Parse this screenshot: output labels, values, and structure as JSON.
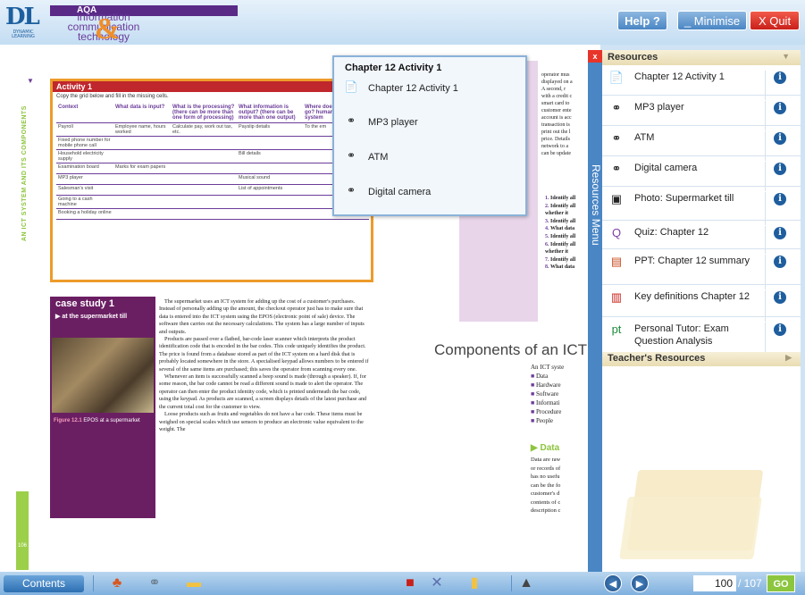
{
  "header": {
    "logo_big": "DL",
    "logo_small": "DYNAMIC LEARNING",
    "badge": "AQA",
    "title_lines": [
      "information",
      "communication",
      "technology"
    ],
    "amp": "&",
    "help": "Help ?",
    "minimise": "_ Minimise",
    "quit": "X Quit"
  },
  "book": {
    "side_label": "AN ICT SYSTEM AND ITS COMPONENTS",
    "page_number": "106",
    "activity": {
      "title": "Activity 1",
      "intro": "Copy the grid below and fill in the missing cells.",
      "columns": [
        "Context",
        "What data is input?",
        "What is the processing? (there can be more than one form of processing)",
        "What information is output? (there can be more than one output)",
        "Where does the output go? human or ICT system"
      ],
      "rows": [
        [
          "Payroll",
          "Employee name, hours worked",
          "Calculate pay, work out tax, etc.",
          "Payslip details",
          "To the em"
        ],
        [
          "Fixed phone number for mobile phone call",
          "",
          "",
          "",
          ""
        ],
        [
          "Household electricity supply",
          "",
          "",
          "Bill details",
          ""
        ],
        [
          "Examination board",
          "Marks for exam papers",
          "",
          "",
          ""
        ],
        [
          "MP3 player",
          "",
          "",
          "Musical sound",
          ""
        ],
        [
          "Salesman's visit",
          "",
          "",
          "List of appointments",
          ""
        ],
        [
          "Going to a cash machine",
          "",
          "",
          "",
          ""
        ],
        [
          "Booking a holiday online",
          "",
          "",
          "",
          ""
        ]
      ]
    },
    "case_study": {
      "title": "case study 1",
      "subtitle": "▶ at the supermarket till",
      "caption_label": "Figure 12.1",
      "caption": "EPOS at a supermarket",
      "paragraphs": [
        "The supermarket uses an ICT system for adding up the cost of a customer's purchases. Instead of personally adding up the amount, the checkout operator just has to make sure that data is entered into the ICT system using the EPOS (electronic point of sale) device. The software then carries out the necessary calculations. The system has a large number of inputs and outputs.",
        "Products are passed over a flatbed, bar-code laser scanner which interprets the product identification code that is encoded in the bar codes. This code uniquely identifies the product. The price is found from a database stored as part of the ICT system on a hard disk that is probably located somewhere in the store. A specialised keypad allows numbers to be entered if several of the same items are purchased; this saves the operator from scanning every one.",
        "Whenever an item is successfully scanned a beep sound is made (through a speaker). If, for some reason, the bar code cannot be read a different sound is made to alert the operator. The operator can then enter the product identity code, which is printed underneath the bar code, using the keypad. As products are scanned, a screen displays details of the latest purchase and the current total cost for the customer to view.",
        "Loose products such as fruits and vegetables do not have a bar code. These items must be weighed on special scales which use sensors to produce an electronic value equivalent to the weight. The"
      ]
    },
    "right_text": [
      "operator mus",
      "displayed on a",
      "A second, r",
      "with a credit c",
      "smart card to",
      "customer ente",
      "account is acc",
      "transaction is",
      "print out the l",
      "price. Details",
      "network to a",
      "can be update"
    ],
    "right_list": [
      {
        "n": "1.",
        "t": "Identify all"
      },
      {
        "n": "2.",
        "t": "Identify all whether it"
      },
      {
        "n": "3.",
        "t": "Identify all"
      },
      {
        "n": "4.",
        "t": "What data"
      },
      {
        "n": "5.",
        "t": "Identify all"
      },
      {
        "n": "6.",
        "t": "Identify all whether it"
      },
      {
        "n": "7.",
        "t": "Identify all"
      },
      {
        "n": "8.",
        "t": "What data"
      }
    ],
    "components_heading": "Components of an ICT s",
    "components_intro": "An ICT syste",
    "components_list": [
      "Data",
      "Hardware",
      "Software",
      "Informati",
      "Procedure",
      "People"
    ],
    "data_heading": "▶ Data",
    "data_lines": [
      "Data are raw",
      "or records of",
      "has no usefu",
      "can be the fo",
      "customer's d",
      "contents of c",
      "description c"
    ]
  },
  "popup": {
    "title": "Chapter 12 Activity 1",
    "items": [
      {
        "icon": "word-doc-icon",
        "label": "Chapter 12 Activity 1"
      },
      {
        "icon": "link-icon",
        "label": "MP3 player"
      },
      {
        "icon": "link-icon",
        "label": "ATM"
      },
      {
        "icon": "link-icon",
        "label": "Digital camera"
      }
    ]
  },
  "resources": {
    "tab_label": "Resources Menu",
    "close": "x",
    "heading": "Resources",
    "items": [
      {
        "icon": "word-doc-icon",
        "label": "Chapter 12 Activity 1"
      },
      {
        "icon": "link-icon",
        "label": "MP3 player"
      },
      {
        "icon": "link-icon",
        "label": "ATM"
      },
      {
        "icon": "link-icon",
        "label": "Digital camera"
      },
      {
        "icon": "camera-icon",
        "label": "Photo: Supermarket till"
      },
      {
        "icon": "quiz-icon",
        "label": "Quiz: Chapter 12"
      },
      {
        "icon": "powerpoint-icon",
        "label": "PPT: Chapter 12 summary"
      },
      {
        "icon": "pdf-icon",
        "label": "Key definitions Chapter 12"
      },
      {
        "icon": "personal-tutor-icon",
        "label": "Personal Tutor: Exam Question Analysis"
      }
    ],
    "teacher_heading": "Teacher's Resources"
  },
  "footer": {
    "contents": "Contents",
    "current_page": "100",
    "total_pages": "/ 107",
    "go": "GO"
  }
}
